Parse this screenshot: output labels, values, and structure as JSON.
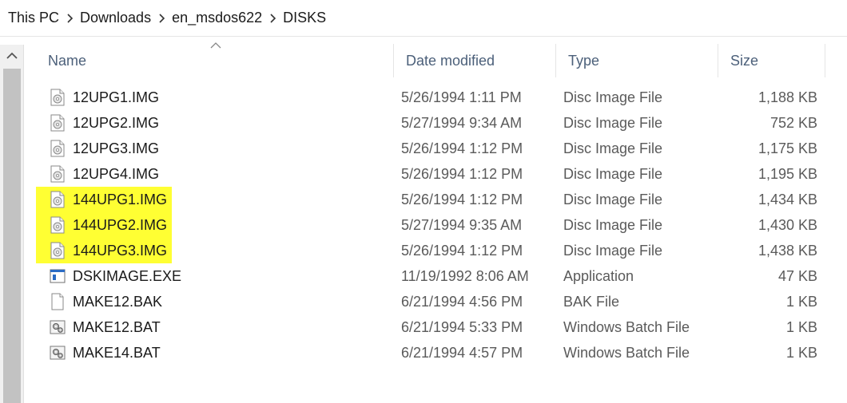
{
  "breadcrumb": [
    "This PC",
    "Downloads",
    "en_msdos622",
    "DISKS"
  ],
  "columns": {
    "name": "Name",
    "date": "Date modified",
    "type": "Type",
    "size": "Size"
  },
  "files": [
    {
      "name": "12UPG1.IMG",
      "date": "5/26/1994 1:11 PM",
      "type": "Disc Image File",
      "size": "1,188 KB",
      "icon": "disc-image-icon",
      "highlighted": false
    },
    {
      "name": "12UPG2.IMG",
      "date": "5/27/1994 9:34 AM",
      "type": "Disc Image File",
      "size": "752 KB",
      "icon": "disc-image-icon",
      "highlighted": false
    },
    {
      "name": "12UPG3.IMG",
      "date": "5/26/1994 1:12 PM",
      "type": "Disc Image File",
      "size": "1,175 KB",
      "icon": "disc-image-icon",
      "highlighted": false
    },
    {
      "name": "12UPG4.IMG",
      "date": "5/26/1994 1:12 PM",
      "type": "Disc Image File",
      "size": "1,195 KB",
      "icon": "disc-image-icon",
      "highlighted": false
    },
    {
      "name": "144UPG1.IMG",
      "date": "5/26/1994 1:12 PM",
      "type": "Disc Image File",
      "size": "1,434 KB",
      "icon": "disc-image-icon",
      "highlighted": true
    },
    {
      "name": "144UPG2.IMG",
      "date": "5/27/1994 9:35 AM",
      "type": "Disc Image File",
      "size": "1,430 KB",
      "icon": "disc-image-icon",
      "highlighted": true
    },
    {
      "name": "144UPG3.IMG",
      "date": "5/26/1994 1:12 PM",
      "type": "Disc Image File",
      "size": "1,438 KB",
      "icon": "disc-image-icon",
      "highlighted": true
    },
    {
      "name": "DSKIMAGE.EXE",
      "date": "11/19/1992 8:06 AM",
      "type": "Application",
      "size": "47 KB",
      "icon": "application-icon",
      "highlighted": false
    },
    {
      "name": "MAKE12.BAK",
      "date": "6/21/1994 4:56 PM",
      "type": "BAK File",
      "size": "1 KB",
      "icon": "blank-file-icon",
      "highlighted": false
    },
    {
      "name": "MAKE12.BAT",
      "date": "6/21/1994 5:33 PM",
      "type": "Windows Batch File",
      "size": "1 KB",
      "icon": "batch-file-icon",
      "highlighted": false
    },
    {
      "name": "MAKE14.BAT",
      "date": "6/21/1994 4:57 PM",
      "type": "Windows Batch File",
      "size": "1 KB",
      "icon": "batch-file-icon",
      "highlighted": false
    }
  ],
  "colors": {
    "highlight": "#ffff33",
    "header_text": "#4c607a"
  }
}
